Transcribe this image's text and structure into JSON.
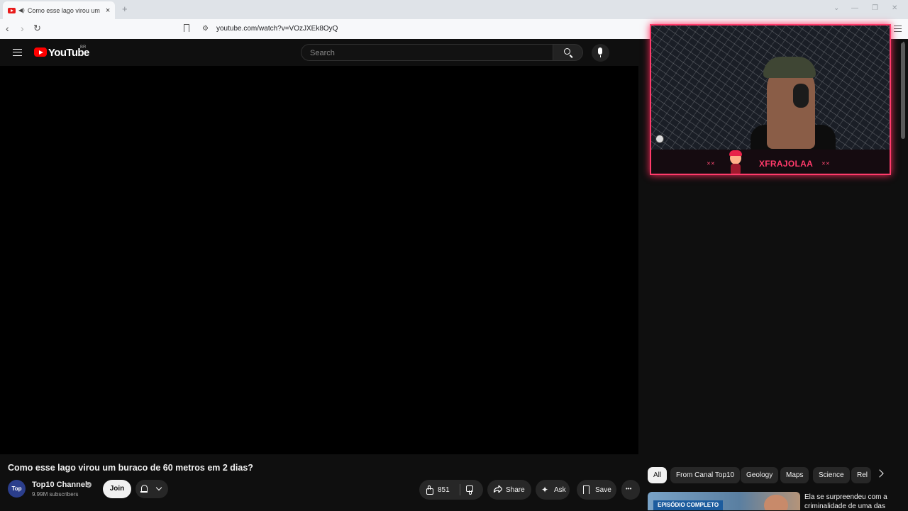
{
  "browser": {
    "tab_title": "Como esse lago virou um bu",
    "new_tab_symbol": "+",
    "close_symbol": "×",
    "url": "youtube.com/watch?v=VOzJXEk8OyQ"
  },
  "youtube": {
    "logo_text": "YouTube",
    "country_code": "BR",
    "search_placeholder": "Search"
  },
  "stream_overlay": {
    "streamer_name": "XFRAJOLAA",
    "marks": [
      "✕✕",
      "✕✕"
    ]
  },
  "video": {
    "title": "Como esse lago virou um buraco de 60 metros em 2 dias?",
    "channel_name": "Top10 Channel",
    "channel_avatar_text": "Top",
    "subscribers": "9.99M subscribers",
    "join_label": "Join",
    "likes": "851",
    "share_label": "Share",
    "ask_label": "Ask",
    "save_label": "Save",
    "more_label": "•••"
  },
  "chips": [
    "All",
    "From Canal Top10",
    "Geology",
    "Maps",
    "Science",
    "Rel"
  ],
  "suggested": {
    "badge": "EPISÓDIO COMPLETO",
    "title": "Ela se surpreendeu com a criminalidade de uma das"
  },
  "colors": {
    "accent": "#ff0000",
    "overlay_border": "#ff3b6b",
    "background": "#0f0f0f"
  }
}
